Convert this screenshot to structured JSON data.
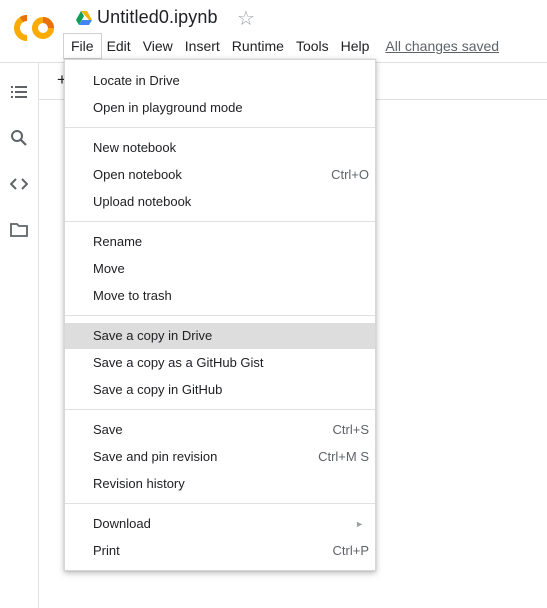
{
  "header": {
    "title": "Untitled0.ipynb",
    "star_glyph": "☆",
    "saved_status": "All changes saved"
  },
  "menubar": {
    "items": [
      "File",
      "Edit",
      "View",
      "Insert",
      "Runtime",
      "Tools",
      "Help"
    ]
  },
  "toolbar": {
    "add_glyph": "+"
  },
  "sidebar": {
    "icons": [
      "toc-icon",
      "search-icon",
      "code-icon",
      "folder-icon"
    ]
  },
  "file_menu": {
    "items": [
      {
        "label": "Locate in Drive",
        "shortcut": ""
      },
      {
        "label": "Open in playground mode",
        "shortcut": ""
      },
      {
        "label": "New notebook",
        "shortcut": ""
      },
      {
        "label": "Open notebook",
        "shortcut": "Ctrl+O"
      },
      {
        "label": "Upload notebook",
        "shortcut": ""
      },
      {
        "label": "Rename",
        "shortcut": ""
      },
      {
        "label": "Move",
        "shortcut": ""
      },
      {
        "label": "Move to trash",
        "shortcut": ""
      },
      {
        "label": "Save a copy in Drive",
        "shortcut": ""
      },
      {
        "label": "Save a copy as a GitHub Gist",
        "shortcut": ""
      },
      {
        "label": "Save a copy in GitHub",
        "shortcut": ""
      },
      {
        "label": "Save",
        "shortcut": "Ctrl+S"
      },
      {
        "label": "Save and pin revision",
        "shortcut": "Ctrl+M S"
      },
      {
        "label": "Revision history",
        "shortcut": ""
      },
      {
        "label": "Download",
        "shortcut": "",
        "submenu_glyph": "►"
      },
      {
        "label": "Print",
        "shortcut": "Ctrl+P"
      }
    ],
    "highlighted_item": "Save a copy in Drive"
  },
  "colors": {
    "logo_orange": "#F9AB00",
    "logo_dark_orange": "#E8710A",
    "drive_green": "#0F9D58",
    "drive_yellow": "#F4B400",
    "drive_blue": "#4285F4",
    "highlight": "#DDDDDD"
  }
}
